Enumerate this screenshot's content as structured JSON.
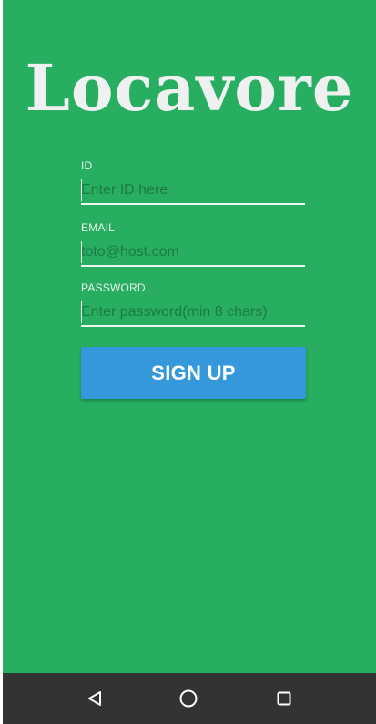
{
  "app": {
    "title": "Locavore",
    "background_color": "#27ae60"
  },
  "form": {
    "id": {
      "label": "ID",
      "value": "",
      "placeholder": "Enter ID here"
    },
    "email": {
      "label": "EMAIL",
      "value": "",
      "placeholder": "toto@host.com"
    },
    "password": {
      "label": "PASSWORD",
      "value": "",
      "placeholder": "Enter password(min 8 chars)"
    },
    "signup_label": "SIGN UP",
    "signup_color": "#3498db"
  },
  "navbar": {
    "back_icon": "back-triangle-icon",
    "home_icon": "home-circle-icon",
    "recent_icon": "recent-apps-square-icon"
  }
}
